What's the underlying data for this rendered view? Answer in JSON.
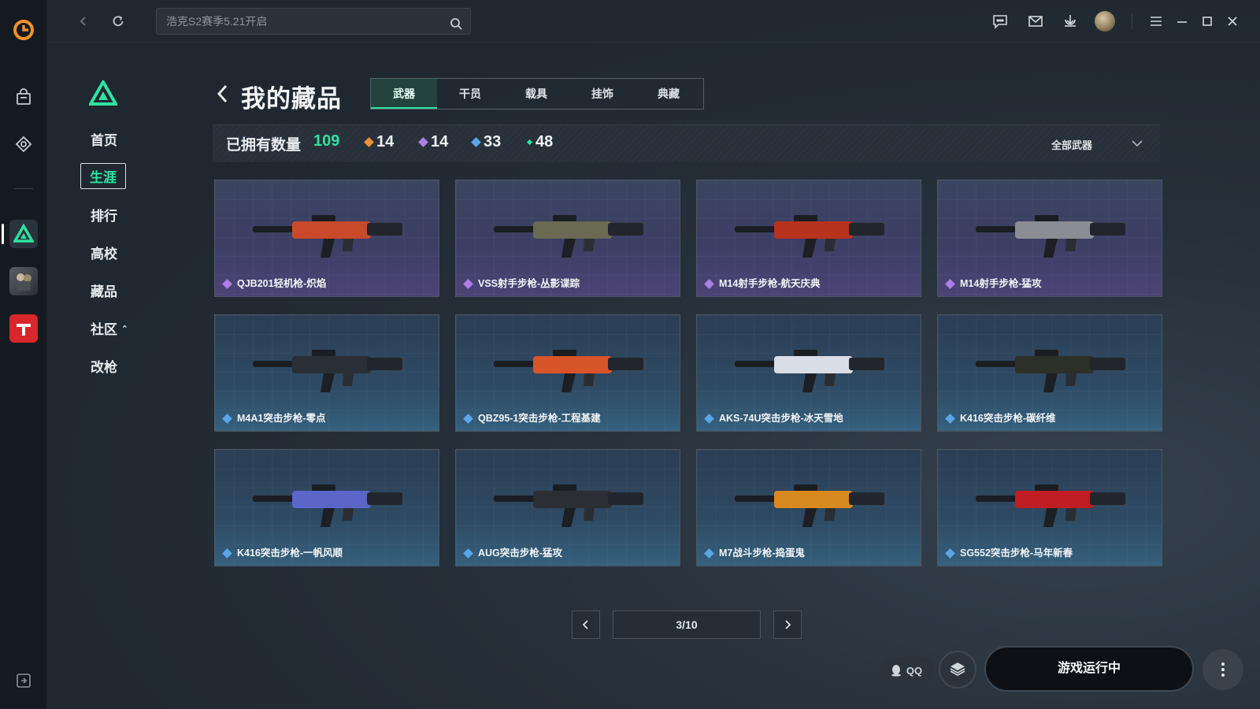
{
  "topbar": {
    "search_placeholder": "浩克S2赛季5.21开启"
  },
  "sidebar": {
    "items": [
      {
        "label": "首页",
        "active": false
      },
      {
        "label": "生涯",
        "active": true
      },
      {
        "label": "排行",
        "active": false
      },
      {
        "label": "高校",
        "active": false
      },
      {
        "label": "藏品",
        "active": false
      },
      {
        "label": "社区",
        "active": false
      },
      {
        "label": "改枪",
        "active": false
      }
    ]
  },
  "header": {
    "title": "我的藏品",
    "tabs": [
      {
        "label": "武器",
        "active": true
      },
      {
        "label": "干员",
        "active": false
      },
      {
        "label": "载具",
        "active": false
      },
      {
        "label": "挂饰",
        "active": false
      },
      {
        "label": "典藏",
        "active": false
      }
    ]
  },
  "stats": {
    "owned_label": "已拥有数量",
    "owned_count": "109",
    "tiers": [
      {
        "count": "14",
        "color": "#e8913a"
      },
      {
        "count": "14",
        "color": "#b07ee8"
      },
      {
        "count": "33",
        "color": "#5aa6e8"
      },
      {
        "count": "48",
        "color": "#2fe3a1"
      }
    ],
    "filter_label": "全部武器"
  },
  "items": [
    {
      "name": "QJB201轻机枪-炽焰",
      "rarity": "purple",
      "color": "#c84a2a"
    },
    {
      "name": "VSS射手步枪-丛影谍踪",
      "rarity": "purple",
      "color": "#6a6a52"
    },
    {
      "name": "M14射手步枪-航天庆典",
      "rarity": "purple",
      "color": "#b8321e"
    },
    {
      "name": "M14射手步枪-猛攻",
      "rarity": "purple",
      "color": "#8a8e94"
    },
    {
      "name": "M4A1突击步枪-零点",
      "rarity": "blue",
      "color": "#2a2f36"
    },
    {
      "name": "QBZ95-1突击步枪-工程基建",
      "rarity": "blue",
      "color": "#d8552a"
    },
    {
      "name": "AKS-74U突击步枪-冰天雪地",
      "rarity": "blue",
      "color": "#d8dde6"
    },
    {
      "name": "K416突击步枪-碳纤维",
      "rarity": "blue",
      "color": "#2c3026"
    },
    {
      "name": "K416突击步枪-一帆风顺",
      "rarity": "blue",
      "color": "#5a66c8"
    },
    {
      "name": "AUG突击步枪-猛攻",
      "rarity": "blue",
      "color": "#2b2e33"
    },
    {
      "name": "M7战斗步枪-捣蛋鬼",
      "rarity": "blue",
      "color": "#d88a1e"
    },
    {
      "name": "SG552突击步枪-马年新春",
      "rarity": "blue",
      "color": "#c01e22"
    }
  ],
  "pager": {
    "label": "3/10"
  },
  "footer": {
    "qq_label": "QQ",
    "play_label": "游戏运行中"
  },
  "colors": {
    "accent": "#2fe3a1",
    "rare_purple": "#b07ee8",
    "rare_blue": "#5aa6e8"
  }
}
